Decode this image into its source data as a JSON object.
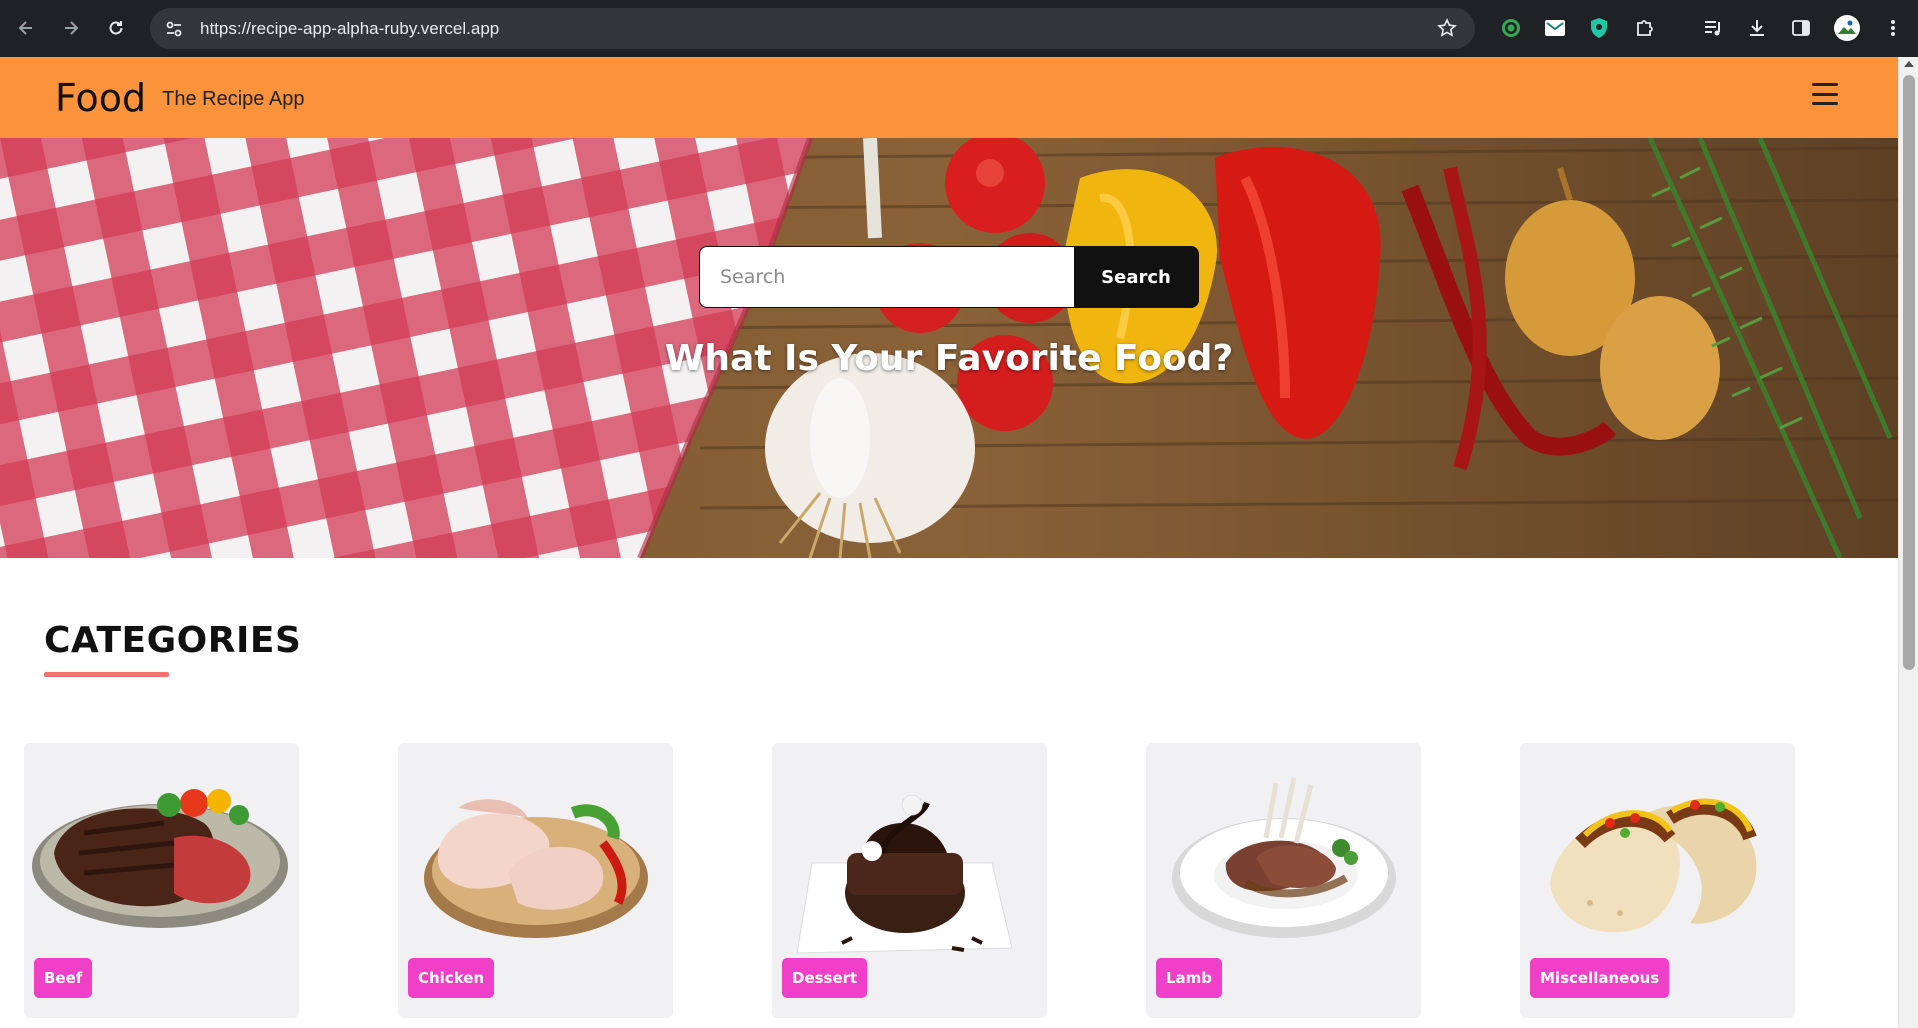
{
  "browser": {
    "url": "https://recipe-app-alpha-ruby.vercel.app",
    "icons": [
      "back-icon",
      "forward-icon",
      "reload-icon",
      "site-settings-icon",
      "star-icon",
      "extension-target-icon",
      "extension-mail-icon",
      "extension-shield-icon",
      "extensions-puzzle-icon",
      "media-icon",
      "download-icon",
      "sidepanel-icon",
      "profile-avatar",
      "more-icon"
    ]
  },
  "header": {
    "brand": "Food",
    "tagline": "The Recipe App",
    "bg_color": "#fb923c"
  },
  "hero": {
    "search_placeholder": "Search",
    "search_value": "",
    "search_button": "Search",
    "title": "What Is Your Favorite Food?"
  },
  "categories": {
    "title": "CATEGORIES",
    "accent_color": "#f87171",
    "badge_color": "#f040c8",
    "items": [
      {
        "label": "Beef"
      },
      {
        "label": "Chicken"
      },
      {
        "label": "Dessert"
      },
      {
        "label": "Lamb"
      },
      {
        "label": "Miscellaneous"
      }
    ]
  }
}
